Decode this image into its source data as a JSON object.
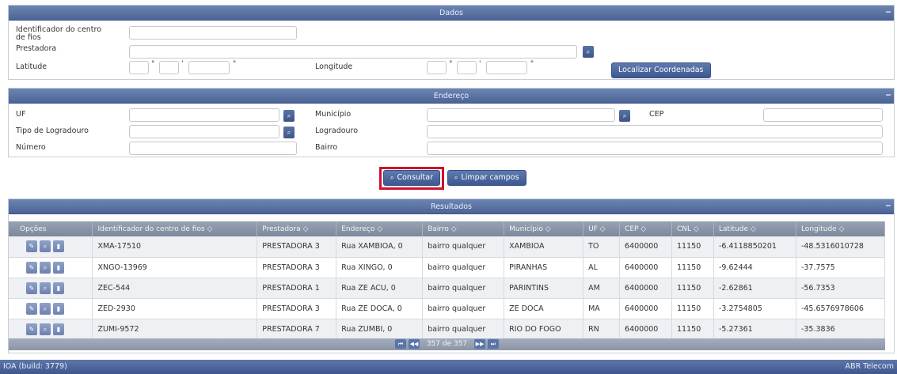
{
  "dados": {
    "title": "Dados",
    "collapse": "−",
    "id_label": "Identificador do centro de fios",
    "prestadora_label": "Prestadora",
    "latitude_label": "Latitude",
    "longitude_label": "Longitude",
    "deg_symbol": "°",
    "min_symbol": "'",
    "sec_symbol": "\"",
    "localizar_label": "Localizar Coordenadas"
  },
  "endereco": {
    "title": "Endereço",
    "collapse": "−",
    "uf_label": "UF",
    "municipio_label": "Município",
    "cep_label": "CEP",
    "tipo_label": "Tipo de Logradouro",
    "logradouro_label": "Logradouro",
    "numero_label": "Número",
    "bairro_label": "Bairro"
  },
  "actions": {
    "consultar_label": "Consultar",
    "limpar_label": "Limpar campos"
  },
  "resultados": {
    "title": "Resultados",
    "collapse": "−",
    "columns": [
      "Opções",
      "Identificador do centro de fios ◇",
      "Prestadora ◇",
      "Endereço ◇",
      "Bairro ◇",
      "Município ◇",
      "UF ◇",
      "CEP ◇",
      "CNL ◇",
      "Latitude ◇",
      "Longitude ◇"
    ],
    "rows": [
      [
        "XMA-17510",
        "PRESTADORA 3",
        "Rua XAMBIOA, 0",
        "bairro qualquer",
        "XAMBIOA",
        "TO",
        "6400000",
        "11150",
        "-6.4118850201",
        "-48.5316010728"
      ],
      [
        "XNGO-13969",
        "PRESTADORA 3",
        "Rua XINGO, 0",
        "bairro qualquer",
        "PIRANHAS",
        "AL",
        "6400000",
        "11150",
        "-9.62444",
        "-37.7575"
      ],
      [
        "ZEC-544",
        "PRESTADORA 1",
        "Rua ZE ACU, 0",
        "bairro qualquer",
        "PARINTINS",
        "AM",
        "6400000",
        "11150",
        "-2.62861",
        "-56.7353"
      ],
      [
        "ZED-2930",
        "PRESTADORA 3",
        "Rua ZE DOCA, 0",
        "bairro qualquer",
        "ZE DOCA",
        "MA",
        "6400000",
        "11150",
        "-3.2754805",
        "-45.6576978606"
      ],
      [
        "ZUMI-9572",
        "PRESTADORA 7",
        "Rua ZUMBI, 0",
        "bairro qualquer",
        "RIO DO FOGO",
        "RN",
        "6400000",
        "11150",
        "-5.27361",
        "-35.3836"
      ]
    ],
    "pager_text": "357 de 357",
    "first_icon": "⏮",
    "prev_icon": "◀◀",
    "next_icon": "▶▶",
    "last_icon": "⏭"
  },
  "footer": {
    "build": "IOA (build: 3779)",
    "company": "ABR Telecom"
  },
  "icons": {
    "search": "⌕",
    "edit": "✎",
    "view": "⌕",
    "delete": "▮"
  },
  "colors": {
    "header_blue": "#4c6496",
    "highlight_red": "#d0112b"
  }
}
